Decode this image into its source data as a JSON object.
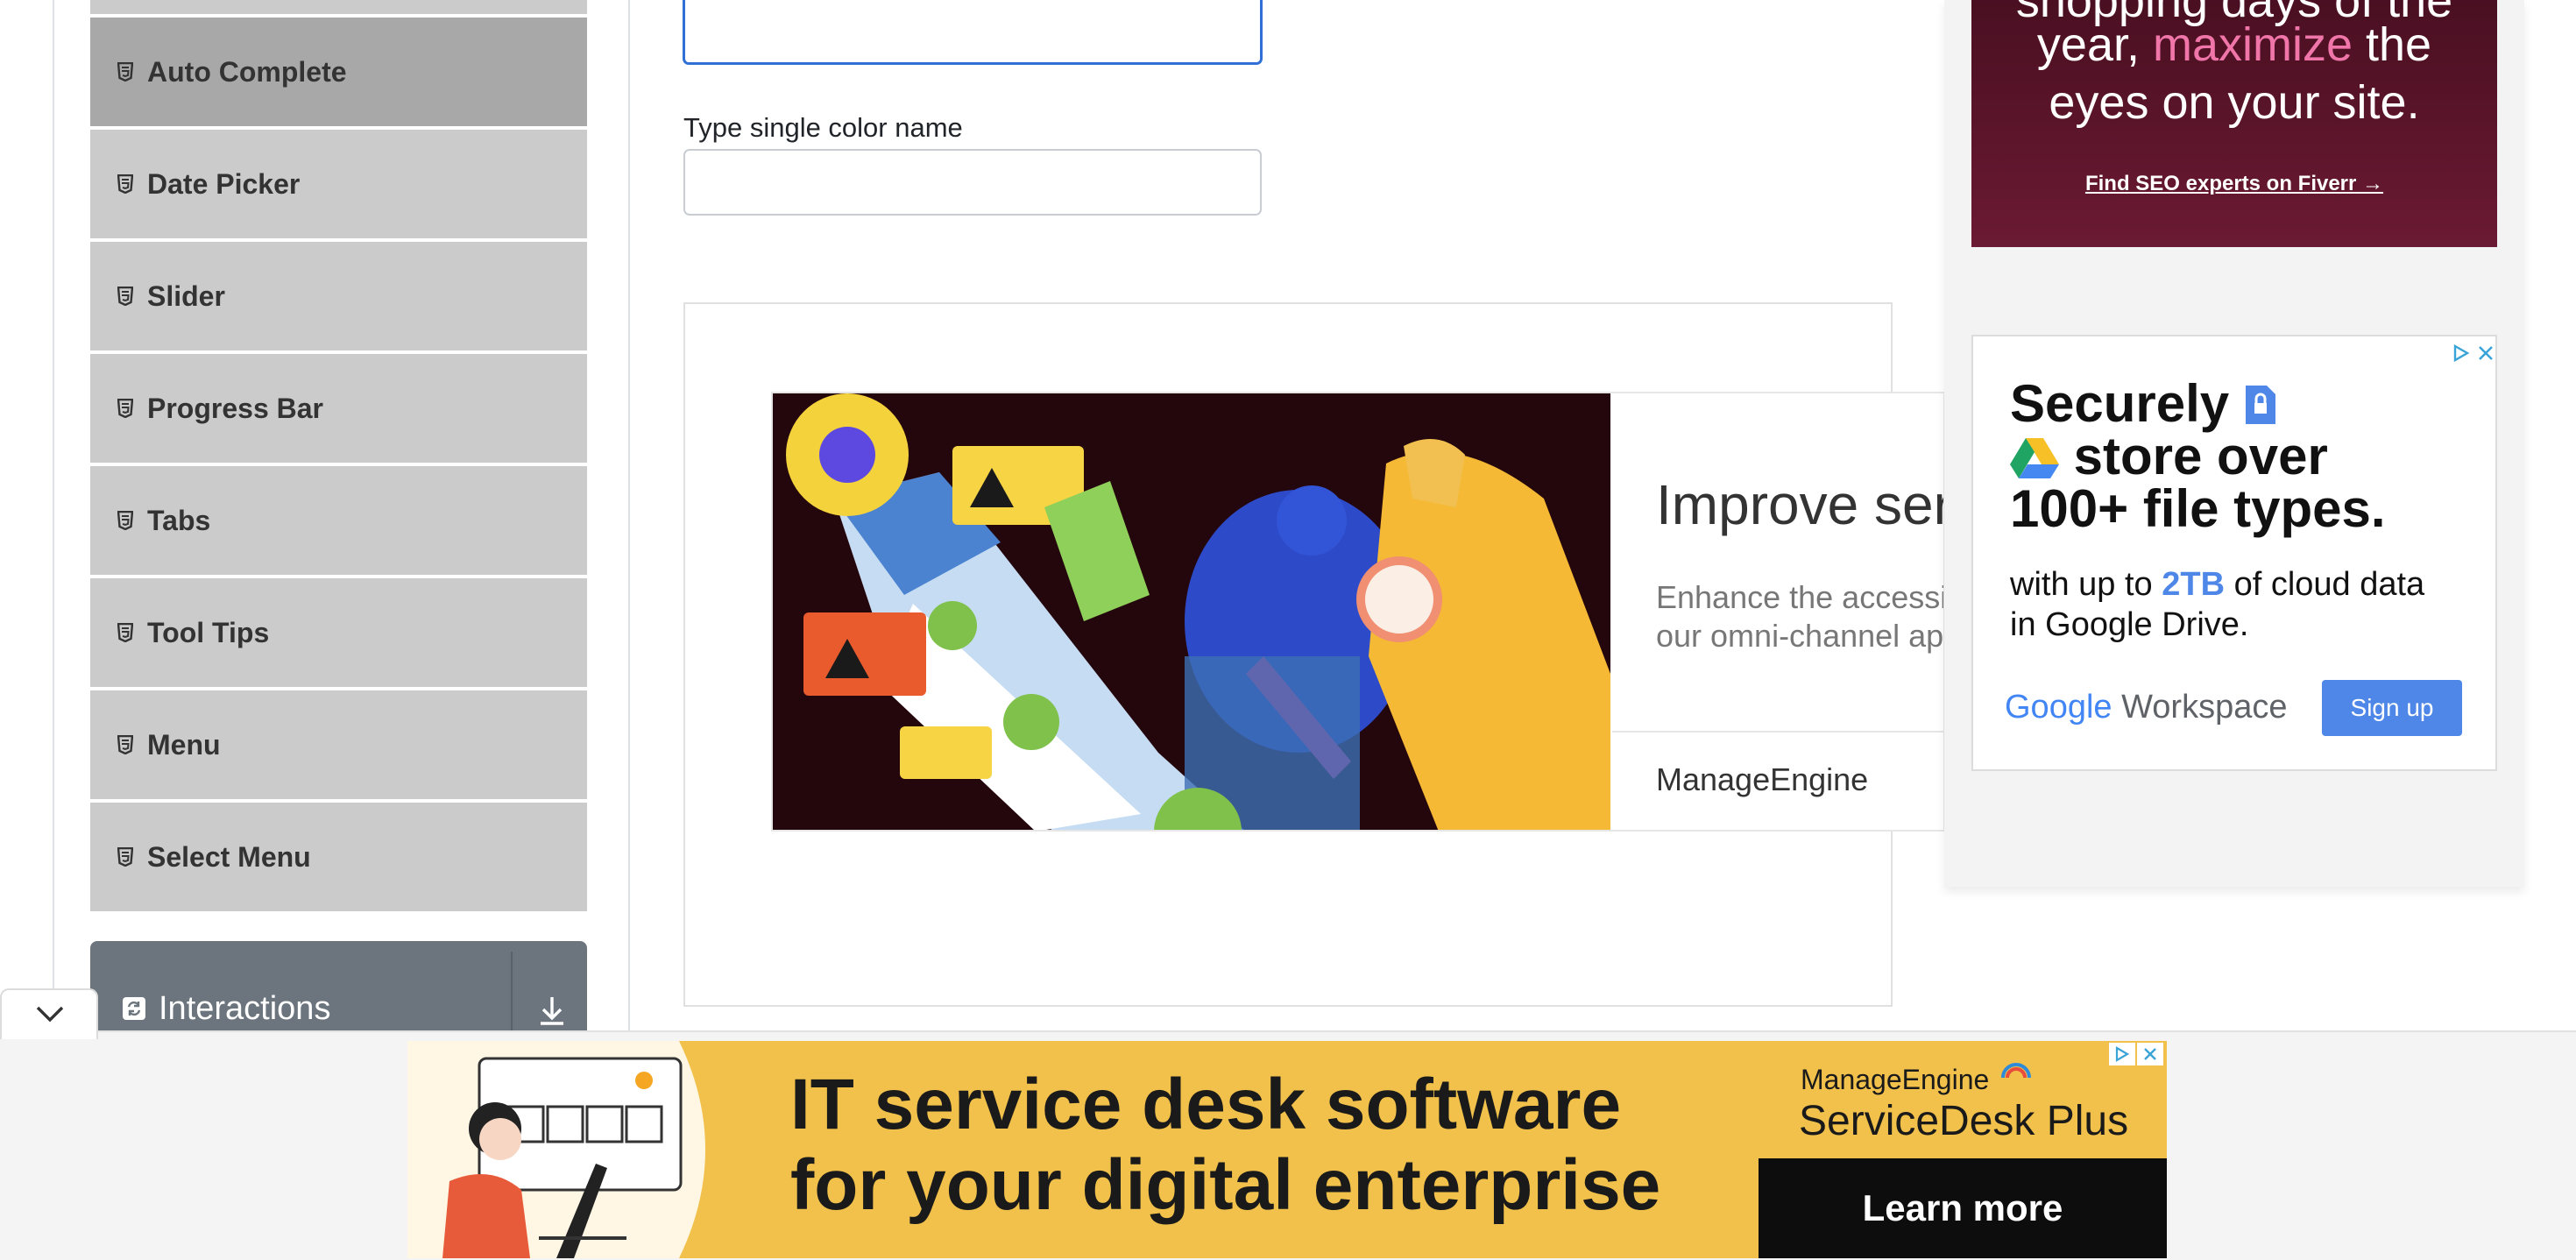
{
  "sidebar": {
    "items": [
      {
        "label": "Auto Complete",
        "active": true
      },
      {
        "label": "Date Picker"
      },
      {
        "label": "Slider"
      },
      {
        "label": "Progress Bar"
      },
      {
        "label": "Tabs"
      },
      {
        "label": "Tool Tips"
      },
      {
        "label": "Menu"
      },
      {
        "label": "Select Menu"
      }
    ],
    "next_group": {
      "label": "Interactions"
    }
  },
  "form": {
    "single_label": "Type single color name",
    "multiple_value": "",
    "single_value": ""
  },
  "ad_inline": {
    "headline": "Improve serv",
    "body_line1": "Enhance the accessil",
    "body_line2": "our omni-channel ap",
    "brand": "ManageEngine"
  },
  "ad_fiverr": {
    "line1": "shopping days of the",
    "line2_a": "year, ",
    "line2_highlight": "maximize",
    "line2_b": " the",
    "line3": "eyes on your site.",
    "cta": "Find SEO experts on Fiverr →"
  },
  "ad_google": {
    "headline_1": "Securely",
    "headline_2": "store over",
    "headline_3": "100+ file types.",
    "body_a": "with up to ",
    "body_highlight": "2TB",
    "body_b": " of cloud data",
    "body_line2": "in Google Drive.",
    "logo_google": "Google",
    "logo_workspace": "Workspace",
    "signup": "Sign up"
  },
  "ad_banner": {
    "headline_1": "IT service desk software",
    "headline_2": "for your digital enterprise",
    "brand_small": "ManageEngine",
    "product": "ServiceDesk Plus",
    "cta": "Learn more"
  },
  "colors": {
    "sidebar_item": "#cbcbcb",
    "sidebar_active": "#a8a8a8",
    "group_header": "#6c757d",
    "focus_border": "#2f6fd6",
    "banner_yellow": "#f1c14b",
    "signup_blue": "#4e87e8",
    "fiverr_pink": "#f075a9"
  }
}
